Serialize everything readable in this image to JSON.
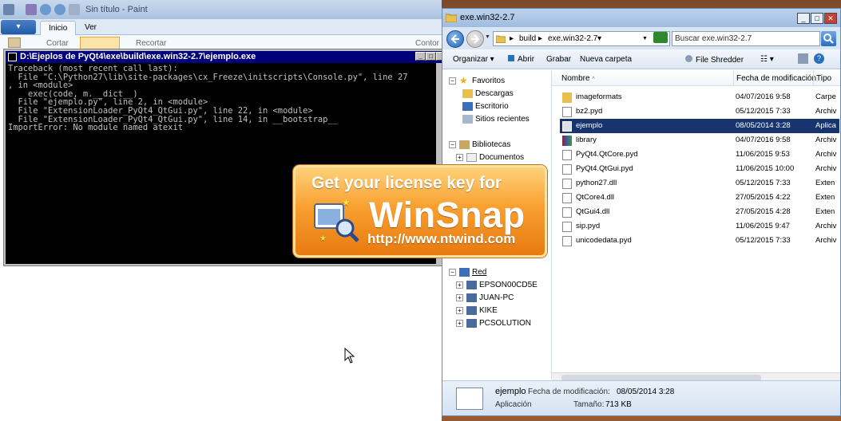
{
  "paint": {
    "title": "Sin título - Paint",
    "menu_button": "▾",
    "tabs": [
      "Inicio",
      "Ver"
    ],
    "ribbon": {
      "cut": "Cortar",
      "crop": "Recortar",
      "outline": "Contor"
    }
  },
  "console": {
    "title": "D:\\Ejeplos de PyQt4\\exe\\build\\exe.win32-2.7\\ejemplo.exe",
    "lines": [
      "Traceback (most recent call last):",
      "  File \"C:\\Python27\\lib\\site-packages\\cx_Freeze\\initscripts\\Console.py\", line 27",
      ", in <module>",
      "    exec(code, m.__dict__)",
      "  File \"ejemplo.py\", line 2, in <module>",
      "  File \"ExtensionLoader_PyQt4_QtGui.py\", line 22, in <module>",
      "  File \"ExtensionLoader_PyQt4_QtGui.py\", line 14, in __bootstrap__",
      "ImportError: No module named atexit"
    ]
  },
  "banner": {
    "top": "Get your license key for",
    "name": "WinSnap",
    "url": "http://www.ntwind.com"
  },
  "explorer": {
    "title": "exe.win32-2.7",
    "address": {
      "crumb1": "build",
      "crumb2": "exe.win32-2.7"
    },
    "search_placeholder": "Buscar exe.win32-2.7",
    "toolbar": {
      "organize": "Organizar",
      "open": "Abrir",
      "burn": "Grabar",
      "new_folder": "Nueva carpeta",
      "shredder": "File Shredder"
    },
    "tree": {
      "favorites": "Favoritos",
      "downloads": "Descargas",
      "desktop": "Escritorio",
      "recent": "Sitios recientes",
      "libraries": "Bibliotecas",
      "documents": "Documentos",
      "network": "Red",
      "pc1": "EPSON00CD5E",
      "pc2": "JUAN-PC",
      "pc3": "KIKE",
      "pc4": "PCSOLUTION"
    },
    "columns": {
      "name": "Nombre",
      "date": "Fecha de modificación",
      "type": "Tipo"
    },
    "files": [
      {
        "name": "imageformats",
        "date": "04/07/2016 9:58",
        "type": "Carpe"
      },
      {
        "name": "bz2.pyd",
        "date": "05/12/2015 7:33",
        "type": "Archiv"
      },
      {
        "name": "ejemplo",
        "date": "08/05/2014 3:28",
        "type": "Aplica"
      },
      {
        "name": "library",
        "date": "04/07/2016 9:58",
        "type": "Archiv"
      },
      {
        "name": "PyQt4.QtCore.pyd",
        "date": "11/06/2015 9:53",
        "type": "Archiv"
      },
      {
        "name": "PyQt4.QtGui.pyd",
        "date": "11/06/2015 10:00",
        "type": "Archiv"
      },
      {
        "name": "python27.dll",
        "date": "05/12/2015 7:33",
        "type": "Exten"
      },
      {
        "name": "QtCore4.dll",
        "date": "27/05/2015 4:22",
        "type": "Exten"
      },
      {
        "name": "QtGui4.dll",
        "date": "27/05/2015 4:28",
        "type": "Exten"
      },
      {
        "name": "sip.pyd",
        "date": "11/06/2015 9:47",
        "type": "Archiv"
      },
      {
        "name": "unicodedata.pyd",
        "date": "05/12/2015 7:33",
        "type": "Archiv"
      }
    ],
    "details": {
      "name": "ejemplo",
      "date_label": "Fecha de modificación:",
      "date_value": "08/05/2014 3:28",
      "type": "Aplicación",
      "size_label": "Tamaño:",
      "size_value": "713 KB"
    }
  },
  "colors": {
    "selection": "#17346e",
    "console_title": "#00007b",
    "banner_orange": "#f8a030"
  }
}
